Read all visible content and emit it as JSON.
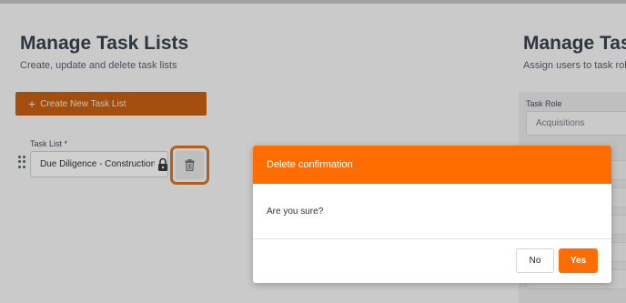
{
  "left": {
    "title": "Manage Task Lists",
    "subtitle": "Create, update and delete task lists",
    "create_button": "Create New Task List",
    "task_list_label": "Task List *",
    "task_list_value": "Due Diligence - Construction"
  },
  "right": {
    "title": "Manage Tasks",
    "subtitle": "Assign users to task roles",
    "task_role_label": "Task Role",
    "task_role_value": "Acquisitions"
  },
  "modal": {
    "title": "Delete confirmation",
    "message": "Are you sure?",
    "no_label": "No",
    "yes_label": "Yes"
  },
  "colors": {
    "accent": "#ff6d00",
    "create_button": "#c25400",
    "highlight_border": "#d46a1a"
  },
  "icons": [
    "plus-icon",
    "drag-handle-icon",
    "lock-icon",
    "trash-icon"
  ]
}
